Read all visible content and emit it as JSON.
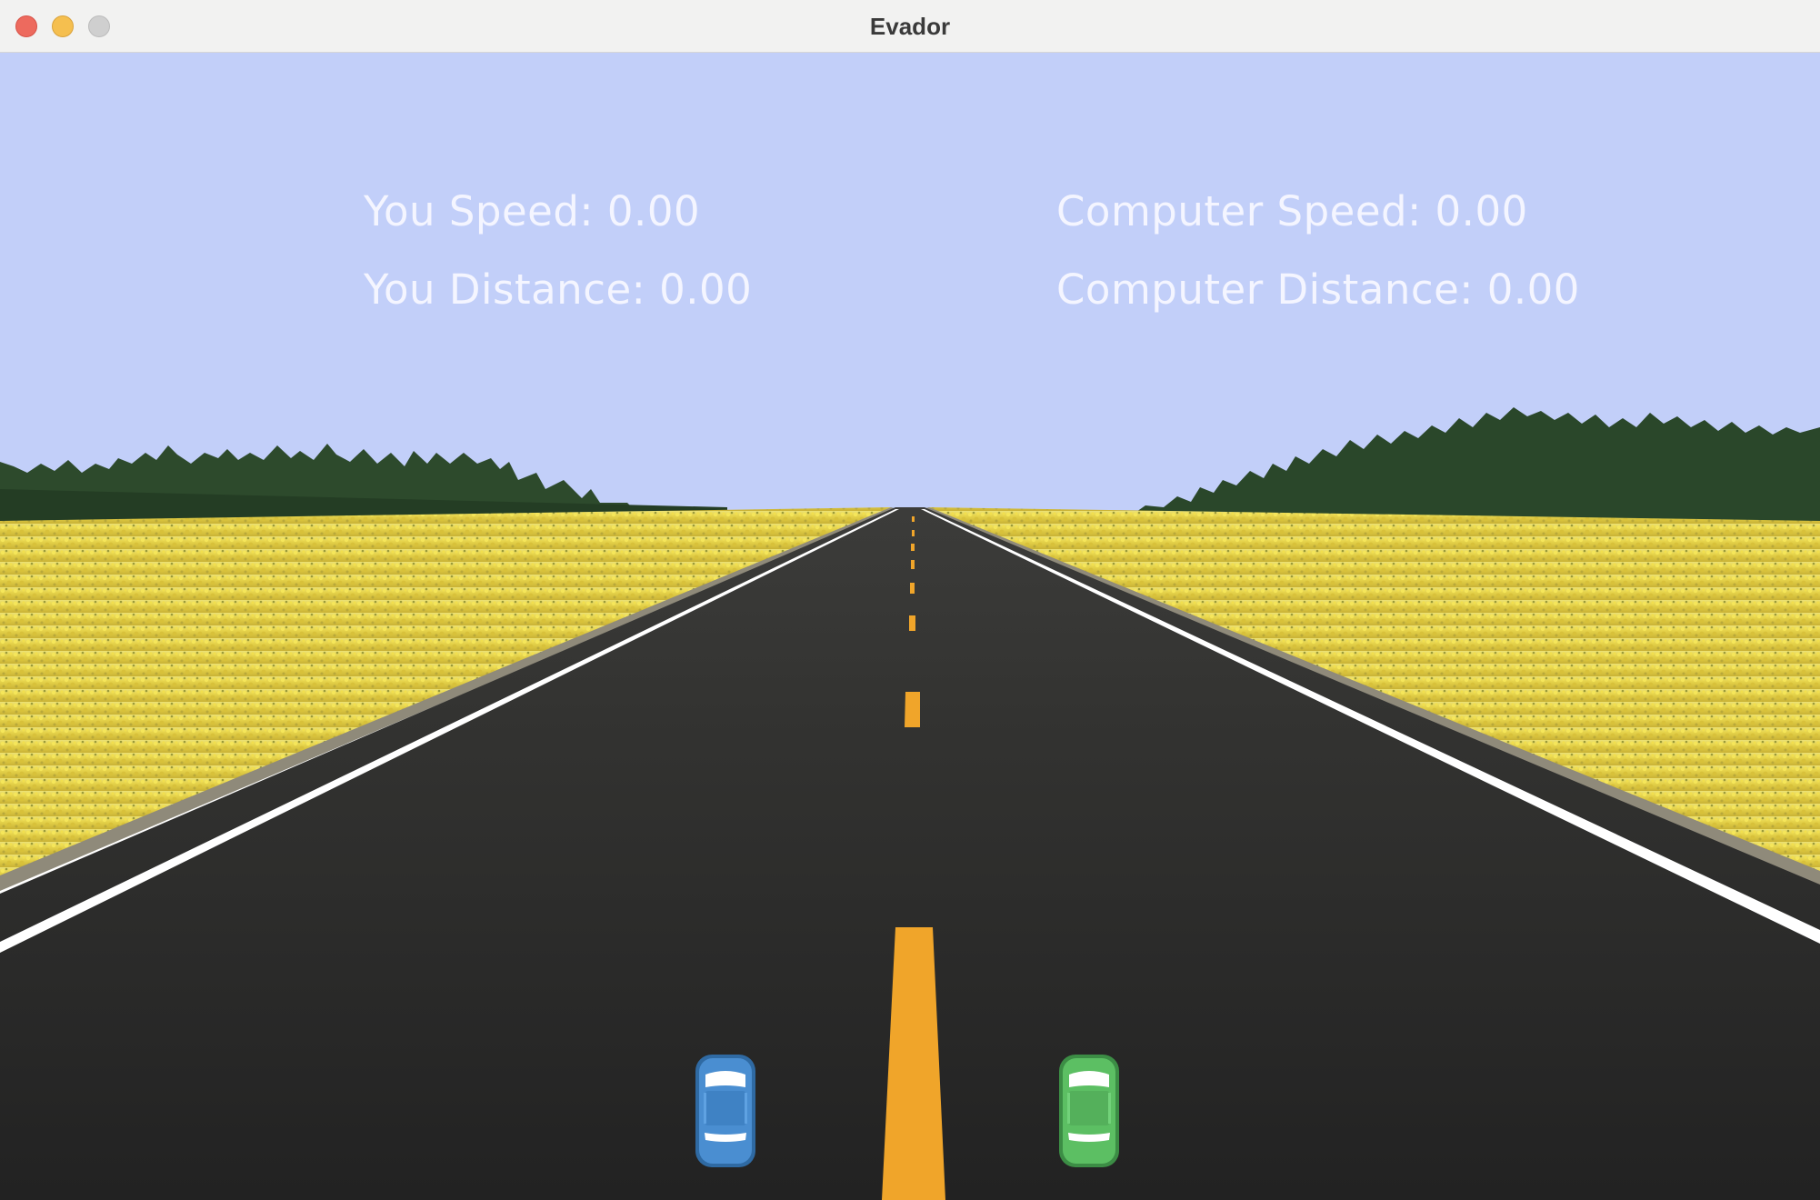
{
  "window": {
    "title": "Evador"
  },
  "hud": {
    "you_speed_label": "You Speed: 0.00",
    "you_distance_label": "You Distance: 0.00",
    "computer_speed_label": "Computer Speed: 0.00",
    "computer_distance_label": "Computer Distance: 0.00"
  },
  "cars": {
    "player_color": "#4a8ed1",
    "computer_color": "#5cbf63"
  },
  "colors": {
    "sky": "#c2cff9",
    "road": "#2e2e2c",
    "field": "#e5d443",
    "lane_marking": "#f0a52a",
    "edge_line": "#ffffff"
  }
}
